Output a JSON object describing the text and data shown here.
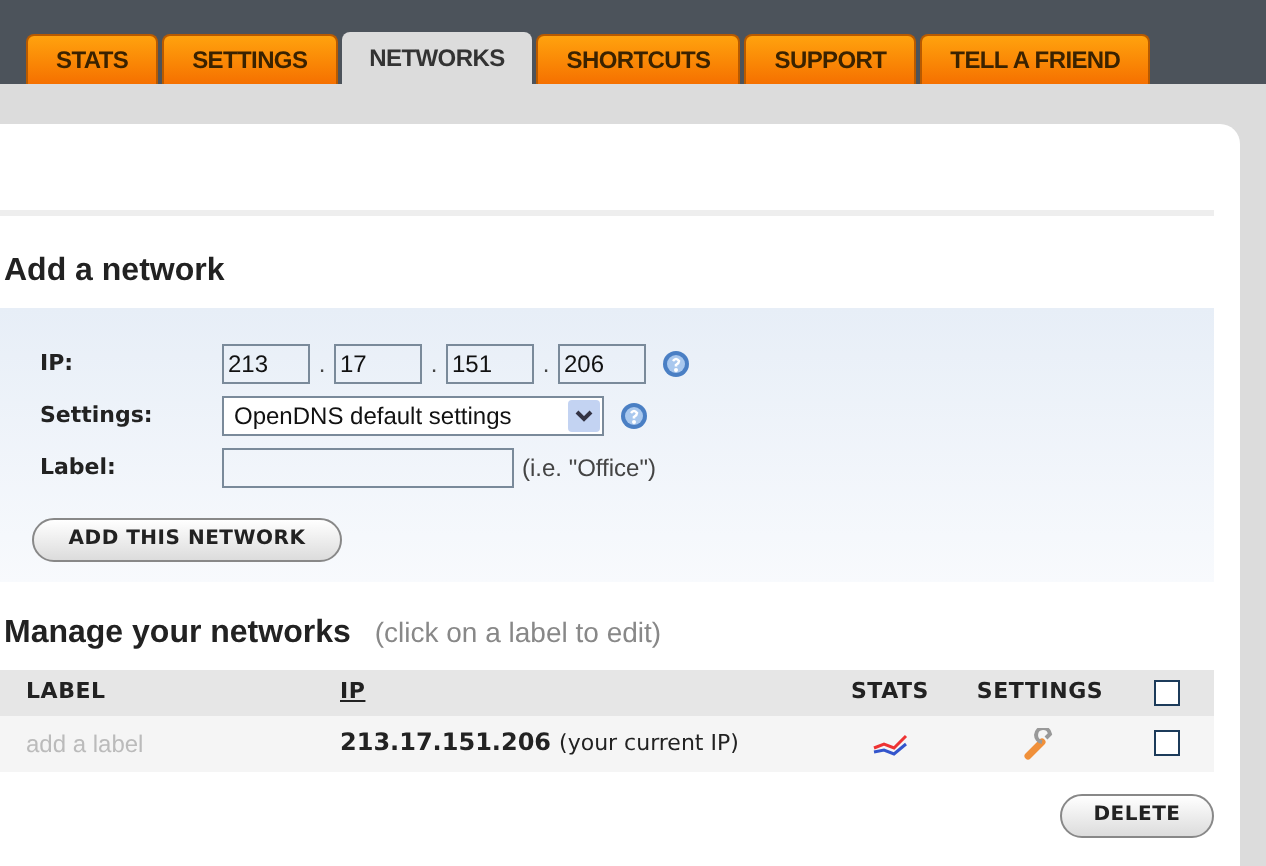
{
  "tabs": [
    {
      "label": "STATS",
      "selected": false
    },
    {
      "label": "SETTINGS",
      "selected": false
    },
    {
      "label": "NETWORKS",
      "selected": true
    },
    {
      "label": "SHORTCUTS",
      "selected": false
    },
    {
      "label": "SUPPORT",
      "selected": false
    },
    {
      "label": "TELL A FRIEND",
      "selected": false
    }
  ],
  "add_network": {
    "title": "Add a network",
    "ip_label": "IP:",
    "ip_octets": [
      "213",
      "17",
      "151",
      "206"
    ],
    "ip_separator": ".",
    "settings_label": "Settings:",
    "settings_value": "OpenDNS default settings",
    "label_label": "Label:",
    "label_hint": "(i.e. \"Office\")",
    "button": "ADD THIS NETWORK"
  },
  "manage": {
    "title": "Manage your networks",
    "hint": "(click on a label to edit)",
    "columns": [
      "LABEL",
      "IP",
      "STATS",
      "SETTINGS"
    ],
    "select_all_checked": false,
    "rows": [
      {
        "label": "add a label",
        "ip": "213.17.151.206",
        "note": "(your current IP)",
        "checked": false
      }
    ],
    "button": "DELETE"
  }
}
